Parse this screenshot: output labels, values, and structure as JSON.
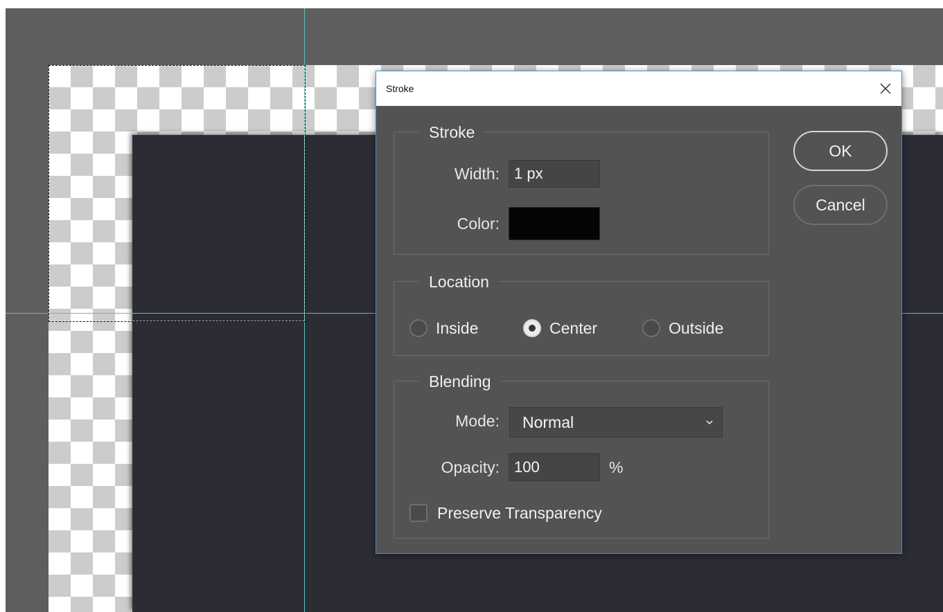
{
  "dialog": {
    "title": "Stroke",
    "close_symbol": "×",
    "stroke_group": {
      "legend": "Stroke",
      "width_label": "Width:",
      "width_value": "1 px",
      "color_label": "Color:",
      "color_value": "#050505"
    },
    "location_group": {
      "legend": "Location",
      "options": [
        {
          "label": "Inside",
          "checked": false
        },
        {
          "label": "Center",
          "checked": true
        },
        {
          "label": "Outside",
          "checked": false
        }
      ]
    },
    "blending_group": {
      "legend": "Blending",
      "mode_label": "Mode:",
      "mode_value": "Normal",
      "opacity_label": "Opacity:",
      "opacity_value": "100",
      "opacity_unit": "%",
      "preserve_label": "Preserve Transparency",
      "preserve_checked": false
    },
    "buttons": {
      "ok": "OK",
      "cancel": "Cancel"
    }
  },
  "colors": {
    "canvas_dark_layer": "#2c2c35",
    "guide": "#4fc5c0",
    "dialog_bg": "#535353",
    "titlebar_bg": "#ffffff",
    "focus_border": "#3e95cf"
  }
}
